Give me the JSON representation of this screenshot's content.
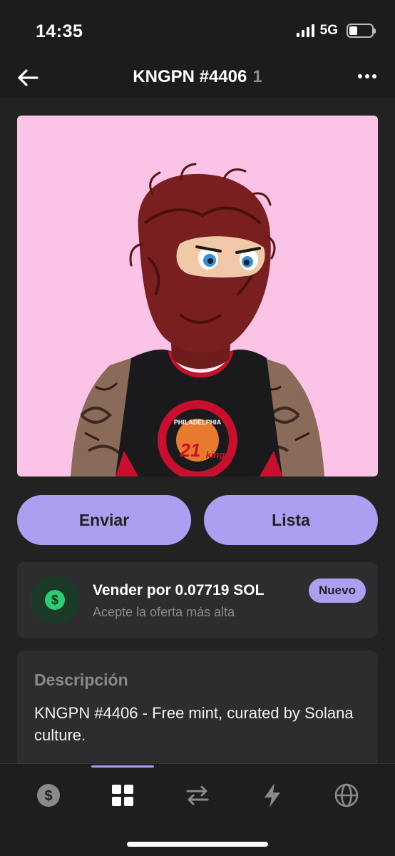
{
  "status_bar": {
    "time": "14:35",
    "network": "5G"
  },
  "header": {
    "title": "KNGPN #4406",
    "count": "1"
  },
  "nft_image": {
    "badge_text": "PHILADELPHIA",
    "badge_number": "21",
    "badge_word": "king"
  },
  "actions": {
    "send_label": "Enviar",
    "list_label": "Lista"
  },
  "offer": {
    "title": "Vender por 0.07719 SOL",
    "subtitle": "Acepte la oferta más alta",
    "badge": "Nuevo",
    "icon": "dollar-icon"
  },
  "description": {
    "label": "Descripción",
    "text": "KNGPN #4406 - Free mint, curated by Solana culture."
  },
  "tabs": [
    {
      "icon": "dollar-icon"
    },
    {
      "icon": "grid-icon",
      "active": true
    },
    {
      "icon": "swap-icon"
    },
    {
      "icon": "lightning-icon"
    },
    {
      "icon": "globe-icon"
    }
  ],
  "colors": {
    "accent": "#ab9ff2",
    "background": "#222222",
    "card": "#2d2d2f",
    "image_bg": "#fbc4e6",
    "success": "#2ecc71"
  }
}
